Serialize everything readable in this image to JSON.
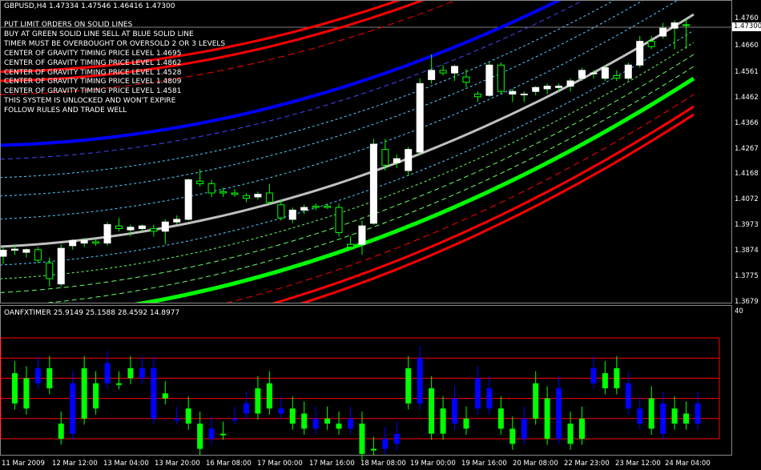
{
  "window": {
    "symbol_line": "GBPUSD,H4  1.47334 1.47546 1.46416 1.47300"
  },
  "notes": [
    "PUT LIMIT ORDERS ON SOLID LINES",
    "BUY AT GREEN SOLID LINE SELL AT BLUE SOLID LINE",
    "TIMER MUST BE OVERBOUGHT OR OVERSOLD 2 OR 3 LEVELS",
    "CENTER OF GRAVITY TIMING PRICE LEVEL  1.4695",
    "CENTER OF GRAVITY TIMING PRICE LEVEL  1.4862",
    "CENTER OF GRAVITY TIMING PRICE LEVEL  1.4528",
    "CENTER OF GRAVITY TIMING PRICE LEVEL  1.4809",
    "CENTER OF GRAVITY TIMING PRICE LEVEL  1.4581",
    " THIS SYSTEM IS UNLOCKED AND WON'T EXPIRE",
    " FOLLOW RULES AND TRADE WELL"
  ],
  "price_axis": {
    "labels": [
      "1.4760",
      "1.4660",
      "1.4561",
      "1.4462",
      "1.4366",
      "1.4267",
      "1.4168",
      "1.4072",
      "1.3973",
      "1.3874",
      "1.3775",
      "1.3679"
    ],
    "current_price": "1.47300"
  },
  "oscillator": {
    "title": "OANFXTIMER  25.9149 25.1588 28.4592 14.8977",
    "axis_label": "40"
  },
  "time_axis": {
    "labels": [
      "11 Mar 2009",
      "12 Mar 12:00",
      "13 Mar 04:00",
      "13 Mar 20:00",
      "16 Mar 08:00",
      "17 Mar 00:00",
      "17 Mar 16:00",
      "18 Mar 08:00",
      "19 Mar 00:00",
      "19 Mar 16:00",
      "20 Mar 08:00",
      "22 Mar 23:00",
      "23 Mar 12:00",
      "24 Mar 04:00"
    ]
  },
  "colors": {
    "background": "#000000",
    "bull_candle": "#ffffff",
    "bear_candle": "#000000",
    "wick": "#00ff00",
    "sell_band": "#0000ff",
    "buy_band": "#00ff00",
    "outer_band": "#ff0000",
    "center_line": "#c0c0c0",
    "osc_up": "#00ff00",
    "osc_down": "#0000ff",
    "osc_level": "#ff0000"
  },
  "chart_data": {
    "type": "candlestick",
    "candles": [
      {
        "o": 1.3855,
        "h": 1.389,
        "l": 1.3825,
        "c": 1.3878
      },
      {
        "o": 1.3878,
        "h": 1.3895,
        "l": 1.386,
        "c": 1.3882
      },
      {
        "o": 1.387,
        "h": 1.3885,
        "l": 1.385,
        "c": 1.388
      },
      {
        "o": 1.388,
        "h": 1.389,
        "l": 1.383,
        "c": 1.384
      },
      {
        "o": 1.383,
        "h": 1.385,
        "l": 1.374,
        "c": 1.377
      },
      {
        "o": 1.375,
        "h": 1.39,
        "l": 1.374,
        "c": 1.3885
      },
      {
        "o": 1.3895,
        "h": 1.392,
        "l": 1.388,
        "c": 1.3915
      },
      {
        "o": 1.3905,
        "h": 1.3925,
        "l": 1.389,
        "c": 1.3915
      },
      {
        "o": 1.391,
        "h": 1.392,
        "l": 1.3895,
        "c": 1.3905
      },
      {
        "o": 1.3905,
        "h": 1.3985,
        "l": 1.3895,
        "c": 1.3975
      },
      {
        "o": 1.397,
        "h": 1.4,
        "l": 1.395,
        "c": 1.396
      },
      {
        "o": 1.3955,
        "h": 1.3975,
        "l": 1.393,
        "c": 1.3965
      },
      {
        "o": 1.396,
        "h": 1.3975,
        "l": 1.395,
        "c": 1.397
      },
      {
        "o": 1.396,
        "h": 1.3975,
        "l": 1.393,
        "c": 1.395
      },
      {
        "o": 1.395,
        "h": 1.3995,
        "l": 1.39,
        "c": 1.3985
      },
      {
        "o": 1.3985,
        "h": 1.401,
        "l": 1.3975,
        "c": 1.3995
      },
      {
        "o": 1.3995,
        "h": 1.415,
        "l": 1.399,
        "c": 1.4145
      },
      {
        "o": 1.414,
        "h": 1.4185,
        "l": 1.412,
        "c": 1.413
      },
      {
        "o": 1.413,
        "h": 1.4145,
        "l": 1.408,
        "c": 1.4095
      },
      {
        "o": 1.41,
        "h": 1.4115,
        "l": 1.408,
        "c": 1.4095
      },
      {
        "o": 1.4095,
        "h": 1.411,
        "l": 1.408,
        "c": 1.409
      },
      {
        "o": 1.4085,
        "h": 1.4095,
        "l": 1.406,
        "c": 1.4075
      },
      {
        "o": 1.408,
        "h": 1.41,
        "l": 1.407,
        "c": 1.409
      },
      {
        "o": 1.4095,
        "h": 1.413,
        "l": 1.405,
        "c": 1.406
      },
      {
        "o": 1.405,
        "h": 1.407,
        "l": 1.399,
        "c": 1.4
      },
      {
        "o": 1.3995,
        "h": 1.404,
        "l": 1.398,
        "c": 1.403
      },
      {
        "o": 1.403,
        "h": 1.405,
        "l": 1.4015,
        "c": 1.404
      },
      {
        "o": 1.4045,
        "h": 1.4055,
        "l": 1.403,
        "c": 1.404
      },
      {
        "o": 1.4045,
        "h": 1.4055,
        "l": 1.4035,
        "c": 1.404
      },
      {
        "o": 1.404,
        "h": 1.4055,
        "l": 1.393,
        "c": 1.3945
      },
      {
        "o": 1.39,
        "h": 1.393,
        "l": 1.388,
        "c": 1.389
      },
      {
        "o": 1.39,
        "h": 1.399,
        "l": 1.386,
        "c": 1.397
      },
      {
        "o": 1.398,
        "h": 1.43,
        "l": 1.3975,
        "c": 1.428
      },
      {
        "o": 1.426,
        "h": 1.43,
        "l": 1.418,
        "c": 1.42
      },
      {
        "o": 1.421,
        "h": 1.424,
        "l": 1.419,
        "c": 1.4225
      },
      {
        "o": 1.418,
        "h": 1.427,
        "l": 1.416,
        "c": 1.426
      },
      {
        "o": 1.425,
        "h": 1.453,
        "l": 1.424,
        "c": 1.451
      },
      {
        "o": 1.4525,
        "h": 1.462,
        "l": 1.451,
        "c": 1.456
      },
      {
        "o": 1.456,
        "h": 1.458,
        "l": 1.454,
        "c": 1.455
      },
      {
        "o": 1.455,
        "h": 1.458,
        "l": 1.452,
        "c": 1.4575
      },
      {
        "o": 1.4535,
        "h": 1.4565,
        "l": 1.4495,
        "c": 1.4515
      },
      {
        "o": 1.447,
        "h": 1.448,
        "l": 1.444,
        "c": 1.446
      },
      {
        "o": 1.4465,
        "h": 1.459,
        "l": 1.446,
        "c": 1.458
      },
      {
        "o": 1.458,
        "h": 1.459,
        "l": 1.447,
        "c": 1.448
      },
      {
        "o": 1.447,
        "h": 1.449,
        "l": 1.444,
        "c": 1.448
      },
      {
        "o": 1.447,
        "h": 1.448,
        "l": 1.444,
        "c": 1.447
      },
      {
        "o": 1.448,
        "h": 1.45,
        "l": 1.4465,
        "c": 1.4495
      },
      {
        "o": 1.449,
        "h": 1.451,
        "l": 1.447,
        "c": 1.45
      },
      {
        "o": 1.4495,
        "h": 1.451,
        "l": 1.448,
        "c": 1.45
      },
      {
        "o": 1.45,
        "h": 1.453,
        "l": 1.448,
        "c": 1.452
      },
      {
        "o": 1.453,
        "h": 1.457,
        "l": 1.452,
        "c": 1.456
      },
      {
        "o": 1.455,
        "h": 1.456,
        "l": 1.453,
        "c": 1.455
      },
      {
        "o": 1.453,
        "h": 1.458,
        "l": 1.452,
        "c": 1.457
      },
      {
        "o": 1.454,
        "h": 1.456,
        "l": 1.452,
        "c": 1.453
      },
      {
        "o": 1.453,
        "h": 1.459,
        "l": 1.452,
        "c": 1.458
      },
      {
        "o": 1.458,
        "h": 1.469,
        "l": 1.457,
        "c": 1.467
      },
      {
        "o": 1.467,
        "h": 1.469,
        "l": 1.464,
        "c": 1.465
      },
      {
        "o": 1.469,
        "h": 1.474,
        "l": 1.468,
        "c": 1.472
      },
      {
        "o": 1.472,
        "h": 1.475,
        "l": 1.464,
        "c": 1.474
      },
      {
        "o": 1.4733,
        "h": 1.4755,
        "l": 1.4642,
        "c": 1.473
      }
    ],
    "osc": [
      [
        5,
        -25
      ],
      [
        0,
        -30
      ],
      [
        10,
        -5
      ],
      [
        10,
        -10
      ],
      [
        -45,
        -60
      ],
      [
        -5,
        -55
      ],
      [
        10,
        -40
      ],
      [
        -5,
        -30
      ],
      [
        15,
        -5
      ],
      [
        -5,
        -5
      ],
      [
        10,
        0
      ],
      [
        0,
        10
      ],
      [
        10,
        -40
      ],
      [
        -15,
        -20
      ],
      [
        -40,
        -40
      ],
      [
        -30,
        -45
      ],
      [
        -45,
        -70
      ],
      [
        -50,
        -60
      ],
      [
        -55,
        -55
      ],
      [
        -40,
        -40
      ],
      [
        -35,
        -25
      ],
      [
        -10,
        -35
      ],
      [
        -5,
        -30
      ],
      [
        -30,
        -35
      ],
      [
        -30,
        -45
      ],
      [
        -35,
        -50
      ],
      [
        -40,
        -50
      ],
      [
        -40,
        -45
      ],
      [
        -45,
        -50
      ],
      [
        -40,
        -50
      ],
      [
        -45,
        -75
      ],
      [
        -70,
        -70
      ],
      [
        -60,
        -70
      ],
      [
        -55,
        -65
      ],
      [
        10,
        -25
      ],
      [
        20,
        -25
      ],
      [
        -10,
        -55
      ],
      [
        -30,
        -55
      ],
      [
        -20,
        -45
      ],
      [
        -40,
        -50
      ],
      [
        0,
        -30
      ],
      [
        -10,
        -30
      ],
      [
        -30,
        -50
      ],
      [
        -50,
        -65
      ],
      [
        -40,
        -60
      ],
      [
        -5,
        -40
      ],
      [
        -20,
        -60
      ],
      [
        -10,
        -60
      ],
      [
        -45,
        -65
      ],
      [
        -40,
        -60
      ],
      [
        10,
        -5
      ],
      [
        -10,
        5
      ],
      [
        10,
        -10
      ],
      [
        -5,
        -30
      ],
      [
        -30,
        -45
      ],
      [
        -20,
        -50
      ],
      [
        -25,
        -55
      ],
      [
        -30,
        -45
      ],
      [
        -35,
        -45
      ],
      [
        -25,
        -45
      ]
    ],
    "osc_levels": [
      40,
      20,
      0,
      -20,
      -40,
      -60
    ]
  }
}
